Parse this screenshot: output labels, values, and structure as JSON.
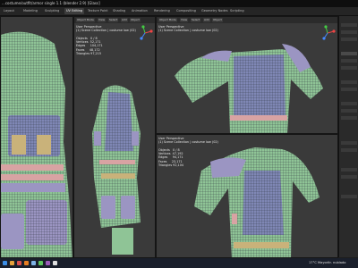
{
  "window": {
    "title": "...costume/outfit/armor single 1.1 (blender 2.9) [Glass]"
  },
  "workspaces": [
    "Layout",
    "Modeling",
    "Sculpting",
    "UV Editing",
    "Texture Paint",
    "Shading",
    "Animation",
    "Rendering",
    "Compositing",
    "Geometry Nodes",
    "Scripting"
  ],
  "active_workspace_index": 3,
  "viewport_header": {
    "mode": "Object Mode",
    "view": "View",
    "select": "Select",
    "add": "Add",
    "object": "Object"
  },
  "viewports": [
    {
      "name": "top-left",
      "label": "User Perspective",
      "collection": "(1) Scene Collection | costume low (02)",
      "stats": "Objects   0 / 8\nVertices  52,171\nEdges     104,171\nFaces     48,172\nTriangles 97,215"
    },
    {
      "name": "top-right",
      "label": "User Perspective",
      "collection": "(1) Scene Collection | costume low (02)",
      "stats": ""
    },
    {
      "name": "bottom-right",
      "label": "User Perspective",
      "collection": "(1) Scene Collection | costume low (02)",
      "stats": "Objects   0 / 8\nVertices  47,192\nEdges     94,171\nFaces     23,171\nTriangles 92,104"
    }
  ],
  "colors": {
    "cloth": "#8fc496",
    "armor": "#7f87b5",
    "pouch": "#9b95c2",
    "skin": "#d8a3a3",
    "strap": "#c9b27a",
    "gridline": "#2a2f3a",
    "bg": "#3a3a3a"
  },
  "taskbar": {
    "weather": "17°C  Mayoritr. nublado"
  }
}
